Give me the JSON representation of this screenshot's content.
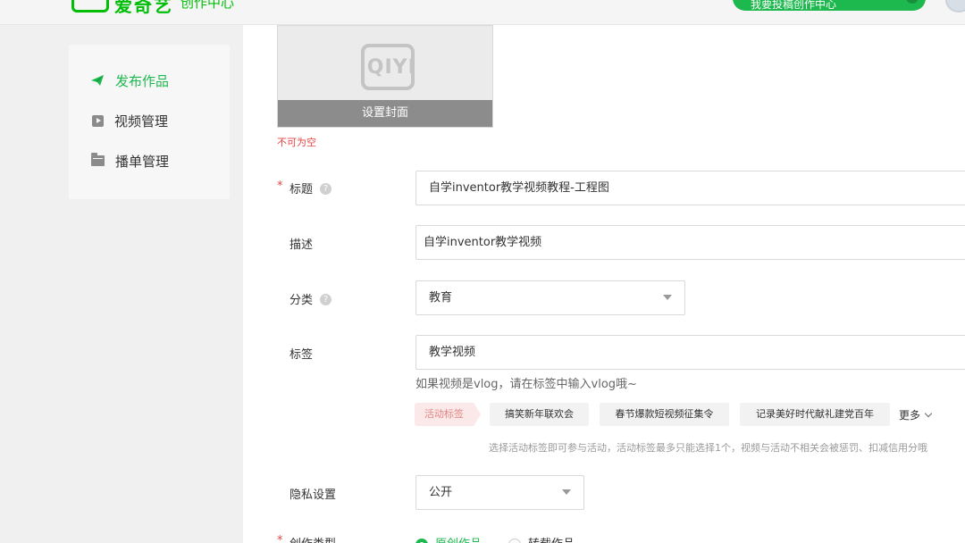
{
  "header": {
    "logo_text": "爱奇艺",
    "logo_sub": "创作中心",
    "top_button": "我要投稿创作中心",
    "colors": {
      "brand": "#00be06",
      "accent": "#1db84e"
    }
  },
  "sidebar": {
    "items": [
      {
        "label": "发布作品",
        "icon": "send-icon",
        "active": true
      },
      {
        "label": "视频管理",
        "icon": "video-play-icon",
        "active": false
      },
      {
        "label": "播单管理",
        "icon": "folder-icon",
        "active": false
      }
    ]
  },
  "cover": {
    "logo": "iQIYI",
    "button": "设置封面",
    "error": "不可为空"
  },
  "form": {
    "title": {
      "required": "*",
      "label": "标题",
      "value": "自学inventor教学视频教程-工程图"
    },
    "description": {
      "label": "描述",
      "value": "自学inventor教学视频"
    },
    "category": {
      "label": "分类",
      "value": "教育"
    },
    "tags": {
      "label": "标签",
      "value": "教学视频",
      "hint": "如果视频是vlog，请在标签中输入vlog哦~",
      "activity_label": "活动标签",
      "activity_tags": [
        "搞笑新年联欢会",
        "春节爆款短视频征集令",
        "记录美好时代献礼建党百年"
      ],
      "more": "更多",
      "activity_hint": "选择活动标签即可参与活动，活动标签最多只能选择1个，视频与活动不相关会被惩罚、扣减信用分哦"
    },
    "privacy": {
      "label": "隐私设置",
      "value": "公开"
    },
    "creation_type": {
      "required": "*",
      "label": "创作类型",
      "options": [
        "原创作品",
        "转载作品"
      ],
      "selected": "原创作品"
    }
  }
}
